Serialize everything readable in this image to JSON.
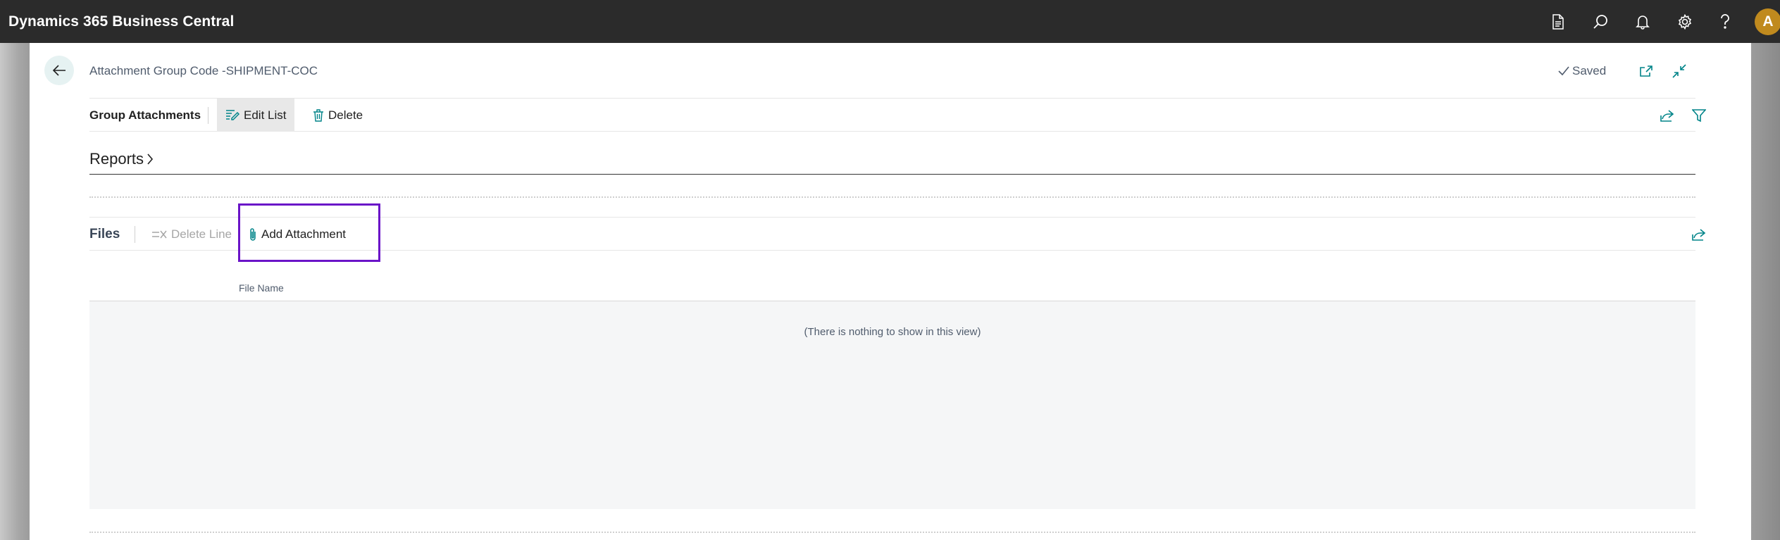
{
  "app": {
    "title": "Dynamics 365 Business Central",
    "avatar_initial": "A"
  },
  "topbar_icons": [
    "reports-icon",
    "search-icon",
    "bell-icon",
    "gear-icon",
    "help-icon"
  ],
  "header": {
    "page_title": "Attachment Group Code -SHIPMENT-COC",
    "saved_label": "Saved"
  },
  "group_actions": {
    "title": "Group Attachments",
    "edit_list_label": "Edit List",
    "delete_label": "Delete"
  },
  "reports": {
    "label": "Reports"
  },
  "files_actions": {
    "title": "Files",
    "delete_line_label": "Delete Line",
    "add_attachment_label": "Add Attachment"
  },
  "grid": {
    "columns": [
      "File Name"
    ],
    "empty_message": "(There is nothing to show in this view)"
  },
  "colors": {
    "accent": "#008489",
    "highlight": "#6a14c8",
    "appbar": "#2b2b2b",
    "avatar": "#c08a1e"
  }
}
